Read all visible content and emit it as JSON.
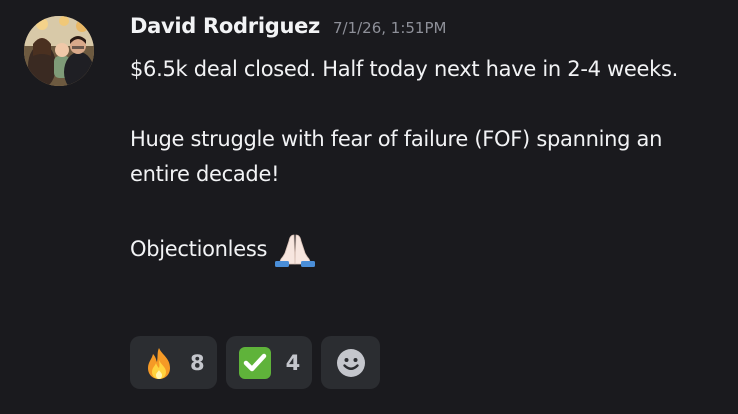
{
  "message": {
    "author": "David Rodriguez",
    "timestamp": "7/1/26, 1:51PM",
    "paragraph1": "$6.5k deal closed. Half today next have in 2-4 weeks.",
    "paragraph2": "Huge struggle with fear of failure (FOF) spanning an entire decade!",
    "paragraph3": "Objectionless",
    "inline_emoji": "folded-hands-emoji"
  },
  "reactions": [
    {
      "emoji": "fire-emoji",
      "count": "8"
    },
    {
      "emoji": "white-check-mark-emoji",
      "count": "4"
    }
  ],
  "add_reaction": {
    "icon": "smiley-icon"
  },
  "colors": {
    "background": "#1a1a1e",
    "reaction_bg": "#2b2d31",
    "text": "#f2f3f5",
    "muted": "#8e9099",
    "check_green": "#5fb33a"
  }
}
